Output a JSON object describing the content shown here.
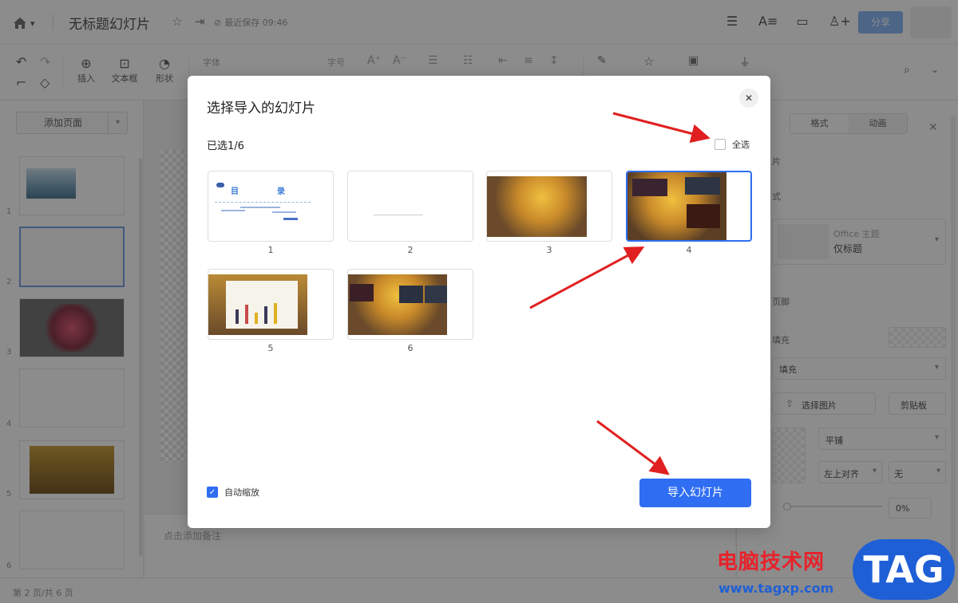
{
  "titlebar": {
    "title": "无标题幻灯片",
    "saved": "最近保存 09:46",
    "share": "分享"
  },
  "toolbar": {
    "insert": "插入",
    "textbox": "文本框",
    "shape": "形状",
    "font": "字体",
    "fontsize": "字号"
  },
  "leftpanel": {
    "add_page": "添加页面",
    "slide_numbers": [
      "1",
      "2",
      "3",
      "4",
      "5",
      "6"
    ]
  },
  "canvas": {
    "notes_placeholder": "点击添加备注"
  },
  "rightpanel": {
    "tab_format": "格式",
    "tab_animation": "动画",
    "theme_title": "Office 主题",
    "theme_layout": "仅标题",
    "label_footer": "页脚",
    "label_fill": "填充",
    "fill_option": "填充",
    "choose_image": "选择图片",
    "clipboard": "剪贴板",
    "tile": "平铺",
    "align": "左上对齐",
    "none": "无",
    "transparency": "0%",
    "partial_top": "片",
    "partial_style": "式"
  },
  "statusbar": {
    "page_info": "第 2 页/共 6 页"
  },
  "dialog": {
    "title": "选择导入的幻灯片",
    "selected": "已选1/6",
    "select_all": "全选",
    "auto_zoom": "自动缩放",
    "import_button": "导入幻灯片",
    "slides": [
      {
        "num": "1",
        "heading_left": "目",
        "heading_right": "录"
      },
      {
        "num": "2"
      },
      {
        "num": "3"
      },
      {
        "num": "4"
      },
      {
        "num": "5"
      },
      {
        "num": "6"
      }
    ]
  },
  "watermark": {
    "text": "电脑技术网",
    "url": "www.tagxp.com",
    "badge": "TAG"
  },
  "colors": {
    "accent": "#2f6ef2",
    "share_button": "#8cb8f5",
    "annotation_arrow": "#e02020"
  }
}
